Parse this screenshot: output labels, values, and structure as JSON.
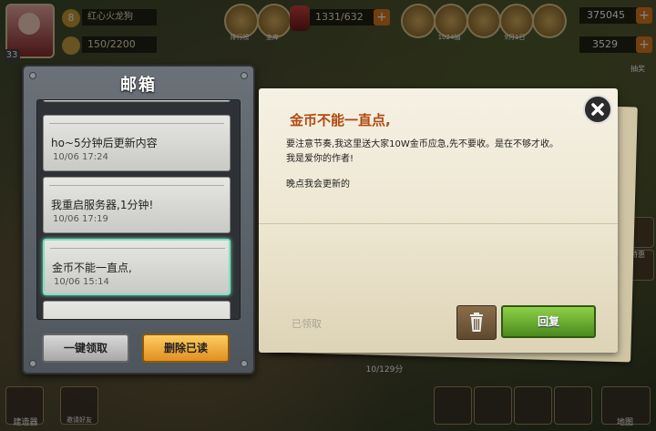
{
  "hud": {
    "player_name": "红心火龙狗",
    "vip_level": "8",
    "player_level": "33",
    "stamina": "150/2200",
    "resource": "1331/632",
    "gold": "375045",
    "gems": "3529",
    "top_icons": [
      "排行榜",
      "金库",
      "",
      "",
      "1024抽",
      "",
      "9月1日",
      "",
      ""
    ],
    "right_labels": [
      "抽奖",
      "特惠"
    ],
    "bottom_left_label": "建造器",
    "bottom_friend_label": "邀请好友",
    "bottom_right_label": "地图",
    "bottom_center": "10/129分"
  },
  "mailbox": {
    "title": "邮箱",
    "mails": [
      {
        "title": "ho~5分钟后更新内容",
        "time": "10/06 17:24",
        "selected": false
      },
      {
        "title": "我重启服务器,1分钟!",
        "time": "10/06 17:19",
        "selected": false
      },
      {
        "title": "金币不能一直点,",
        "time": "10/06 15:14",
        "selected": true
      }
    ],
    "claim_all_label": "一键领取",
    "delete_read_label": "删除已读"
  },
  "letter": {
    "title": "金币不能一直点,",
    "body_lines": [
      "要注意节奏,我这里送大家10W金币应急,先不要收。是在不够才收。",
      "我是爱你的作者!"
    ],
    "closing": "晚点我会更新的",
    "claimed_label": "已领取",
    "reply_label": "回复"
  },
  "colors": {
    "letter_title": "#b04a10",
    "selected_border": "#7fe0c0",
    "delete_button": "#ffcc60",
    "reply_button": "#6fb034"
  }
}
